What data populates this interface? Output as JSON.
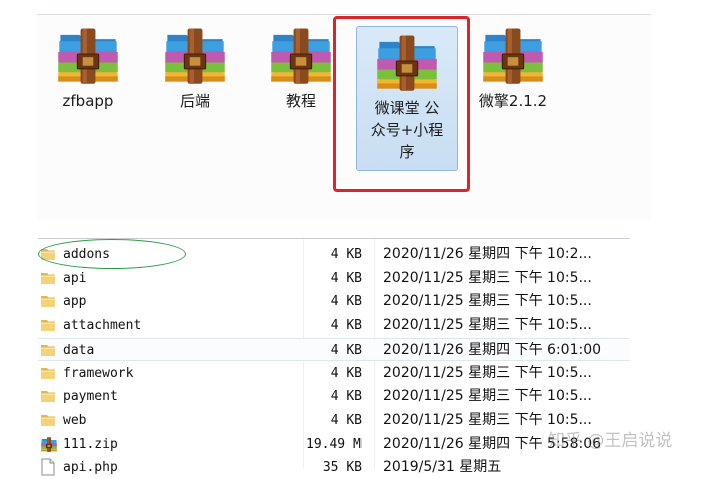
{
  "icon_view": {
    "items": [
      {
        "label": "zfbapp",
        "icon": "winrar-archive-icon"
      },
      {
        "label": "后端",
        "icon": "winrar-archive-icon"
      },
      {
        "label": "教程",
        "icon": "winrar-archive-icon"
      },
      {
        "label_lines": [
          "微课堂 公",
          "众号+小程",
          "序"
        ],
        "icon": "winrar-archive-icon",
        "selected": true
      },
      {
        "label": "微擎2.1.2",
        "icon": "winrar-archive-icon"
      }
    ],
    "highlight_color": "#d9262b"
  },
  "details_view": {
    "annotation_color": "#2e9e43",
    "rows": [
      {
        "name": "addons",
        "size": "4 KB",
        "date": "2020/11/26 星期四 下午 10:2...",
        "icon": "folder-icon"
      },
      {
        "name": "api",
        "size": "4 KB",
        "date": "2020/11/25 星期三 下午 10:5...",
        "icon": "folder-icon"
      },
      {
        "name": "app",
        "size": "4 KB",
        "date": "2020/11/25 星期三 下午 10:5...",
        "icon": "folder-icon"
      },
      {
        "name": "attachment",
        "size": "4 KB",
        "date": "2020/11/25 星期三 下午 10:5...",
        "icon": "folder-icon"
      },
      {
        "name": "data",
        "size": "4 KB",
        "date": "2020/11/26 星期四 下午 6:01:00",
        "icon": "folder-icon",
        "highlighted": true
      },
      {
        "name": "framework",
        "size": "4 KB",
        "date": "2020/11/25 星期三 下午 10:5...",
        "icon": "folder-icon"
      },
      {
        "name": "payment",
        "size": "4 KB",
        "date": "2020/11/25 星期三 下午 10:5...",
        "icon": "folder-icon"
      },
      {
        "name": "web",
        "size": "4 KB",
        "date": "2020/11/25 星期三 下午 10:5...",
        "icon": "folder-icon"
      },
      {
        "name": "111.zip",
        "size": "19.49 MB",
        "date": "2020/11/26 星期四 下午 5:58:06",
        "icon": "winrar-archive-icon"
      },
      {
        "name": "api.php",
        "size": "35 KB",
        "date": "2019/5/31 星期五",
        "icon": "php-file-icon"
      }
    ]
  },
  "watermark": "知乎 @王启说说"
}
